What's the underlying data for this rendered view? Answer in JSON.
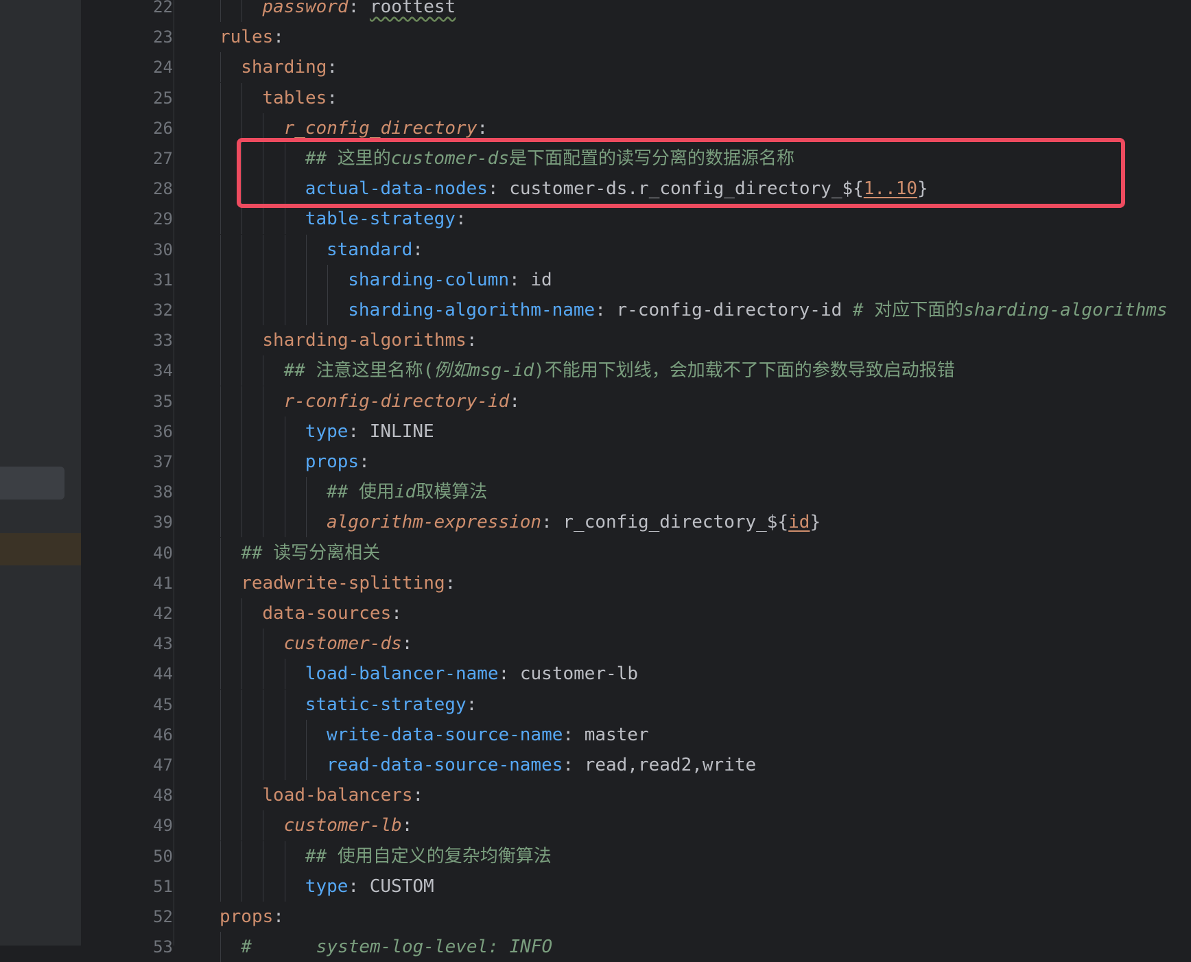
{
  "lines": [
    {
      "n": "22",
      "indent": 5,
      "parts": [
        {
          "cls": "ki",
          "t": "password"
        },
        {
          "cls": "p",
          "t": ": "
        },
        {
          "cls": "v ul",
          "t": "roottest"
        }
      ]
    },
    {
      "n": "23",
      "indent": 3,
      "parts": [
        {
          "cls": "k",
          "t": "rules"
        },
        {
          "cls": "p",
          "t": ":"
        }
      ]
    },
    {
      "n": "24",
      "indent": 4,
      "parts": [
        {
          "cls": "k",
          "t": "sharding"
        },
        {
          "cls": "p",
          "t": ":"
        }
      ]
    },
    {
      "n": "25",
      "indent": 5,
      "parts": [
        {
          "cls": "k",
          "t": "tables"
        },
        {
          "cls": "p",
          "t": ":"
        }
      ]
    },
    {
      "n": "26",
      "indent": 6,
      "parts": [
        {
          "cls": "ki",
          "t": "r_config_directory"
        },
        {
          "cls": "p",
          "t": ":"
        }
      ]
    },
    {
      "n": "27",
      "indent": 7,
      "parts": [
        {
          "cls": "ci",
          "t": "## "
        },
        {
          "cls": "c",
          "t": "这里的"
        },
        {
          "cls": "ci",
          "t": "customer-ds"
        },
        {
          "cls": "c",
          "t": "是下面配置的读写分离的数据源名称"
        }
      ]
    },
    {
      "n": "28",
      "indent": 7,
      "parts": [
        {
          "cls": "kb",
          "t": "actual-data-nodes"
        },
        {
          "cls": "p",
          "t": ": "
        },
        {
          "cls": "v",
          "t": "customer-ds.r_config_directory_${"
        },
        {
          "cls": "num",
          "t": "1..10"
        },
        {
          "cls": "v",
          "t": "}"
        }
      ]
    },
    {
      "n": "29",
      "indent": 7,
      "parts": [
        {
          "cls": "kb",
          "t": "table-strategy"
        },
        {
          "cls": "p",
          "t": ":"
        }
      ]
    },
    {
      "n": "30",
      "indent": 8,
      "parts": [
        {
          "cls": "kb",
          "t": "standard"
        },
        {
          "cls": "p",
          "t": ":"
        }
      ]
    },
    {
      "n": "31",
      "indent": 9,
      "parts": [
        {
          "cls": "kb",
          "t": "sharding-column"
        },
        {
          "cls": "p",
          "t": ": "
        },
        {
          "cls": "v",
          "t": "id"
        }
      ]
    },
    {
      "n": "32",
      "indent": 9,
      "parts": [
        {
          "cls": "kb",
          "t": "sharding-algorithm-name"
        },
        {
          "cls": "p",
          "t": ": "
        },
        {
          "cls": "v",
          "t": "r-config-directory-id "
        },
        {
          "cls": "ci",
          "t": "# "
        },
        {
          "cls": "c",
          "t": "对应下面的"
        },
        {
          "cls": "ci",
          "t": "sharding-algorithms"
        }
      ]
    },
    {
      "n": "33",
      "indent": 5,
      "parts": [
        {
          "cls": "k",
          "t": "sharding-algorithms"
        },
        {
          "cls": "p",
          "t": ":"
        }
      ]
    },
    {
      "n": "34",
      "indent": 6,
      "parts": [
        {
          "cls": "ci",
          "t": "## "
        },
        {
          "cls": "c",
          "t": "注意这里名称("
        },
        {
          "cls": "ci",
          "t": "例如msg-id"
        },
        {
          "cls": "c",
          "t": ")不能用下划线，会加载不了下面的参数导致启动报错"
        }
      ]
    },
    {
      "n": "35",
      "indent": 6,
      "parts": [
        {
          "cls": "ki",
          "t": "r-config-directory-id"
        },
        {
          "cls": "p",
          "t": ":"
        }
      ]
    },
    {
      "n": "36",
      "indent": 7,
      "parts": [
        {
          "cls": "kb",
          "t": "type"
        },
        {
          "cls": "p",
          "t": ": "
        },
        {
          "cls": "v",
          "t": "INLINE"
        }
      ]
    },
    {
      "n": "37",
      "indent": 7,
      "parts": [
        {
          "cls": "kb",
          "t": "props"
        },
        {
          "cls": "p",
          "t": ":"
        }
      ]
    },
    {
      "n": "38",
      "indent": 8,
      "parts": [
        {
          "cls": "ci",
          "t": "## "
        },
        {
          "cls": "c",
          "t": "使用"
        },
        {
          "cls": "ci",
          "t": "id"
        },
        {
          "cls": "c",
          "t": "取模算法"
        }
      ]
    },
    {
      "n": "39",
      "indent": 8,
      "parts": [
        {
          "cls": "ki",
          "t": "algorithm-expression"
        },
        {
          "cls": "p",
          "t": ": "
        },
        {
          "cls": "v",
          "t": "r_config_directory_${"
        },
        {
          "cls": "num",
          "t": "id"
        },
        {
          "cls": "v",
          "t": "}"
        }
      ]
    },
    {
      "n": "40",
      "indent": 4,
      "parts": [
        {
          "cls": "ci",
          "t": "## "
        },
        {
          "cls": "c",
          "t": "读写分离相关"
        }
      ]
    },
    {
      "n": "41",
      "indent": 4,
      "parts": [
        {
          "cls": "k",
          "t": "readwrite-splitting"
        },
        {
          "cls": "p",
          "t": ":"
        }
      ]
    },
    {
      "n": "42",
      "indent": 5,
      "parts": [
        {
          "cls": "k",
          "t": "data-sources"
        },
        {
          "cls": "p",
          "t": ":"
        }
      ]
    },
    {
      "n": "43",
      "indent": 6,
      "parts": [
        {
          "cls": "ki",
          "t": "customer-ds"
        },
        {
          "cls": "p",
          "t": ":"
        }
      ]
    },
    {
      "n": "44",
      "indent": 7,
      "parts": [
        {
          "cls": "kb",
          "t": "load-balancer-name"
        },
        {
          "cls": "p",
          "t": ": "
        },
        {
          "cls": "v",
          "t": "customer-lb"
        }
      ]
    },
    {
      "n": "45",
      "indent": 7,
      "parts": [
        {
          "cls": "kb",
          "t": "static-strategy"
        },
        {
          "cls": "p",
          "t": ":"
        }
      ]
    },
    {
      "n": "46",
      "indent": 8,
      "parts": [
        {
          "cls": "kb",
          "t": "write-data-source-name"
        },
        {
          "cls": "p",
          "t": ": "
        },
        {
          "cls": "v",
          "t": "master"
        }
      ]
    },
    {
      "n": "47",
      "indent": 8,
      "parts": [
        {
          "cls": "kb",
          "t": "read-data-source-names"
        },
        {
          "cls": "p",
          "t": ": "
        },
        {
          "cls": "v",
          "t": "read,read2,write"
        }
      ]
    },
    {
      "n": "48",
      "indent": 5,
      "parts": [
        {
          "cls": "k",
          "t": "load-balancers"
        },
        {
          "cls": "p",
          "t": ":"
        }
      ]
    },
    {
      "n": "49",
      "indent": 6,
      "parts": [
        {
          "cls": "ki",
          "t": "customer-lb"
        },
        {
          "cls": "p",
          "t": ":"
        }
      ]
    },
    {
      "n": "50",
      "indent": 7,
      "parts": [
        {
          "cls": "ci",
          "t": "## "
        },
        {
          "cls": "c",
          "t": "使用自定义的复杂均衡算法"
        }
      ]
    },
    {
      "n": "51",
      "indent": 7,
      "parts": [
        {
          "cls": "kb",
          "t": "type"
        },
        {
          "cls": "p",
          "t": ": "
        },
        {
          "cls": "v",
          "t": "CUSTOM"
        }
      ]
    },
    {
      "n": "52",
      "indent": 3,
      "parts": [
        {
          "cls": "k",
          "t": "props"
        },
        {
          "cls": "p",
          "t": ":"
        }
      ]
    },
    {
      "n": "53",
      "indent": 4,
      "parts": [
        {
          "cls": "ci",
          "t": "#      system-log-level: INFO"
        }
      ]
    }
  ]
}
